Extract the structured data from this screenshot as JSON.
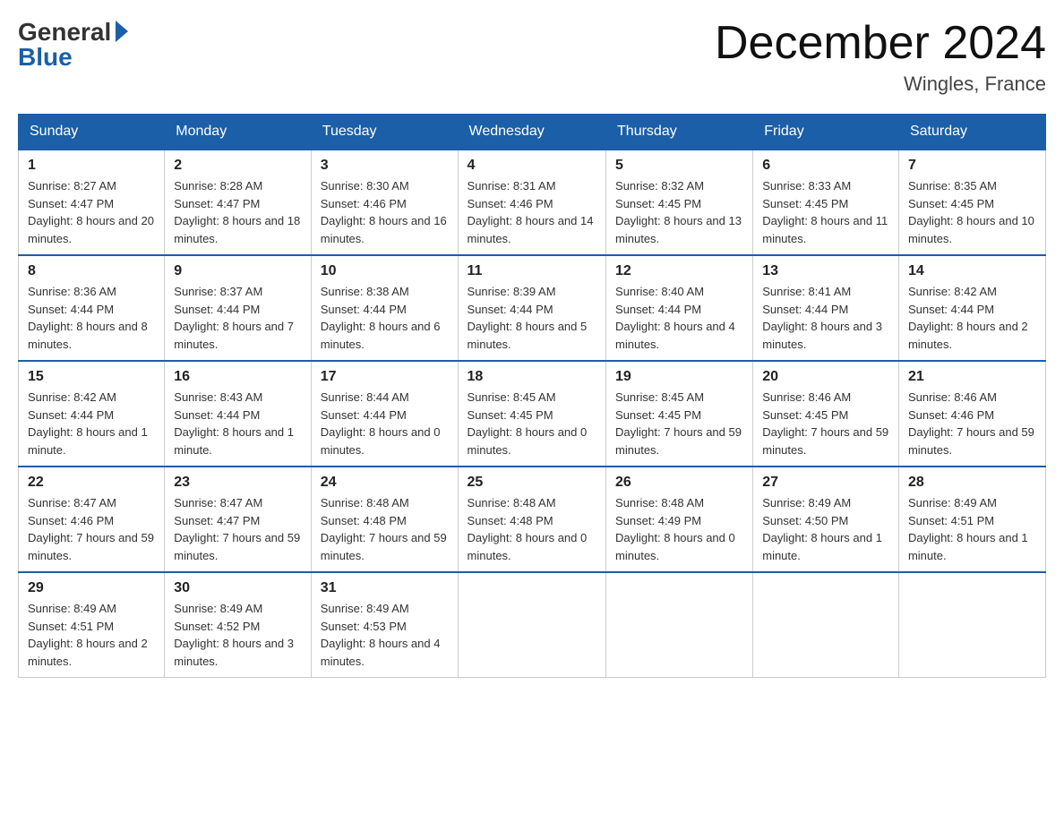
{
  "header": {
    "logo_general": "General",
    "logo_blue": "Blue",
    "month_title": "December 2024",
    "location": "Wingles, France"
  },
  "days_of_week": [
    "Sunday",
    "Monday",
    "Tuesday",
    "Wednesday",
    "Thursday",
    "Friday",
    "Saturday"
  ],
  "weeks": [
    [
      {
        "day": "1",
        "sunrise": "8:27 AM",
        "sunset": "4:47 PM",
        "daylight": "8 hours and 20 minutes."
      },
      {
        "day": "2",
        "sunrise": "8:28 AM",
        "sunset": "4:47 PM",
        "daylight": "8 hours and 18 minutes."
      },
      {
        "day": "3",
        "sunrise": "8:30 AM",
        "sunset": "4:46 PM",
        "daylight": "8 hours and 16 minutes."
      },
      {
        "day": "4",
        "sunrise": "8:31 AM",
        "sunset": "4:46 PM",
        "daylight": "8 hours and 14 minutes."
      },
      {
        "day": "5",
        "sunrise": "8:32 AM",
        "sunset": "4:45 PM",
        "daylight": "8 hours and 13 minutes."
      },
      {
        "day": "6",
        "sunrise": "8:33 AM",
        "sunset": "4:45 PM",
        "daylight": "8 hours and 11 minutes."
      },
      {
        "day": "7",
        "sunrise": "8:35 AM",
        "sunset": "4:45 PM",
        "daylight": "8 hours and 10 minutes."
      }
    ],
    [
      {
        "day": "8",
        "sunrise": "8:36 AM",
        "sunset": "4:44 PM",
        "daylight": "8 hours and 8 minutes."
      },
      {
        "day": "9",
        "sunrise": "8:37 AM",
        "sunset": "4:44 PM",
        "daylight": "8 hours and 7 minutes."
      },
      {
        "day": "10",
        "sunrise": "8:38 AM",
        "sunset": "4:44 PM",
        "daylight": "8 hours and 6 minutes."
      },
      {
        "day": "11",
        "sunrise": "8:39 AM",
        "sunset": "4:44 PM",
        "daylight": "8 hours and 5 minutes."
      },
      {
        "day": "12",
        "sunrise": "8:40 AM",
        "sunset": "4:44 PM",
        "daylight": "8 hours and 4 minutes."
      },
      {
        "day": "13",
        "sunrise": "8:41 AM",
        "sunset": "4:44 PM",
        "daylight": "8 hours and 3 minutes."
      },
      {
        "day": "14",
        "sunrise": "8:42 AM",
        "sunset": "4:44 PM",
        "daylight": "8 hours and 2 minutes."
      }
    ],
    [
      {
        "day": "15",
        "sunrise": "8:42 AM",
        "sunset": "4:44 PM",
        "daylight": "8 hours and 1 minute."
      },
      {
        "day": "16",
        "sunrise": "8:43 AM",
        "sunset": "4:44 PM",
        "daylight": "8 hours and 1 minute."
      },
      {
        "day": "17",
        "sunrise": "8:44 AM",
        "sunset": "4:44 PM",
        "daylight": "8 hours and 0 minutes."
      },
      {
        "day": "18",
        "sunrise": "8:45 AM",
        "sunset": "4:45 PM",
        "daylight": "8 hours and 0 minutes."
      },
      {
        "day": "19",
        "sunrise": "8:45 AM",
        "sunset": "4:45 PM",
        "daylight": "7 hours and 59 minutes."
      },
      {
        "day": "20",
        "sunrise": "8:46 AM",
        "sunset": "4:45 PM",
        "daylight": "7 hours and 59 minutes."
      },
      {
        "day": "21",
        "sunrise": "8:46 AM",
        "sunset": "4:46 PM",
        "daylight": "7 hours and 59 minutes."
      }
    ],
    [
      {
        "day": "22",
        "sunrise": "8:47 AM",
        "sunset": "4:46 PM",
        "daylight": "7 hours and 59 minutes."
      },
      {
        "day": "23",
        "sunrise": "8:47 AM",
        "sunset": "4:47 PM",
        "daylight": "7 hours and 59 minutes."
      },
      {
        "day": "24",
        "sunrise": "8:48 AM",
        "sunset": "4:48 PM",
        "daylight": "7 hours and 59 minutes."
      },
      {
        "day": "25",
        "sunrise": "8:48 AM",
        "sunset": "4:48 PM",
        "daylight": "8 hours and 0 minutes."
      },
      {
        "day": "26",
        "sunrise": "8:48 AM",
        "sunset": "4:49 PM",
        "daylight": "8 hours and 0 minutes."
      },
      {
        "day": "27",
        "sunrise": "8:49 AM",
        "sunset": "4:50 PM",
        "daylight": "8 hours and 1 minute."
      },
      {
        "day": "28",
        "sunrise": "8:49 AM",
        "sunset": "4:51 PM",
        "daylight": "8 hours and 1 minute."
      }
    ],
    [
      {
        "day": "29",
        "sunrise": "8:49 AM",
        "sunset": "4:51 PM",
        "daylight": "8 hours and 2 minutes."
      },
      {
        "day": "30",
        "sunrise": "8:49 AM",
        "sunset": "4:52 PM",
        "daylight": "8 hours and 3 minutes."
      },
      {
        "day": "31",
        "sunrise": "8:49 AM",
        "sunset": "4:53 PM",
        "daylight": "8 hours and 4 minutes."
      },
      null,
      null,
      null,
      null
    ]
  ],
  "labels": {
    "sunrise": "Sunrise:",
    "sunset": "Sunset:",
    "daylight": "Daylight:"
  }
}
